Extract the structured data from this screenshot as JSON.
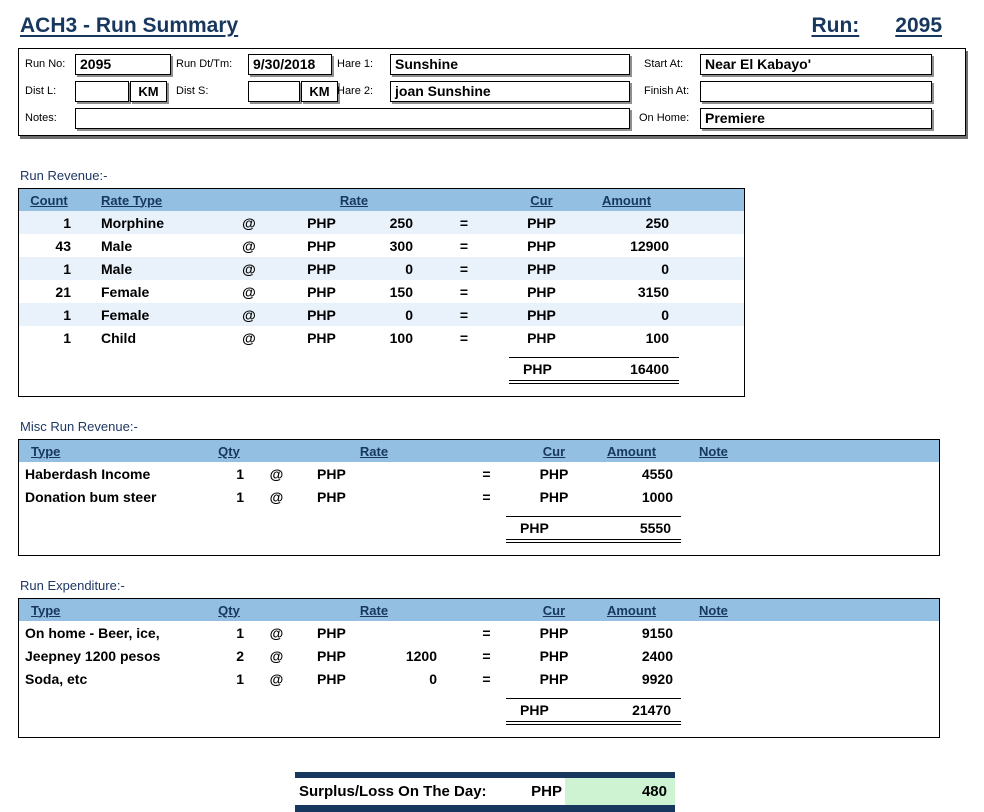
{
  "header": {
    "title": "ACH3 - Run Summary",
    "run_label": "Run:",
    "run_number": "2095"
  },
  "symbols": {
    "at": "@",
    "eq": "=",
    "php": "PHP",
    "km": "KM"
  },
  "form": {
    "run_no_label": "Run No:",
    "run_no": "2095",
    "run_dt_label": "Run Dt/Tm:",
    "run_dt": "9/30/2018",
    "hare1_label": "Hare 1:",
    "hare1": "Sunshine",
    "start_at_label": "Start At:",
    "start_at": "Near El Kabayo'",
    "dist_l_label": "Dist L:",
    "dist_l": "",
    "dist_s_label": "Dist S:",
    "dist_s": "",
    "hare2_label": "Hare 2:",
    "hare2": "joan Sunshine",
    "finish_at_label": "Finish At:",
    "finish_at": "",
    "notes_label": "Notes:",
    "notes": "",
    "on_home_label": "On Home:",
    "on_home": "Premiere"
  },
  "run_revenue": {
    "section_label": "Run Revenue:-",
    "headers": {
      "count": "Count",
      "rate_type": "Rate Type",
      "rate": "Rate",
      "cur": "Cur",
      "amount": "Amount"
    },
    "rows": [
      {
        "count": "1",
        "rate_type": "Morphine",
        "rate": "250",
        "amount": "250"
      },
      {
        "count": "43",
        "rate_type": "Male",
        "rate": "300",
        "amount": "12900"
      },
      {
        "count": "1",
        "rate_type": "Male",
        "rate": "0",
        "amount": "0"
      },
      {
        "count": "21",
        "rate_type": "Female",
        "rate": "150",
        "amount": "3150"
      },
      {
        "count": "1",
        "rate_type": "Female",
        "rate": "0",
        "amount": "0"
      },
      {
        "count": "1",
        "rate_type": "Child",
        "rate": "100",
        "amount": "100"
      }
    ],
    "total_amount": "16400"
  },
  "misc_revenue": {
    "section_label": "Misc Run Revenue:-",
    "headers": {
      "type": "Type",
      "qty": "Qty",
      "rate": "Rate",
      "cur": "Cur",
      "amount": "Amount",
      "note": "Note"
    },
    "rows": [
      {
        "type": "Haberdash Income",
        "qty": "1",
        "rate": "",
        "amount": "4550",
        "note": ""
      },
      {
        "type": "Donation bum steer",
        "qty": "1",
        "rate": "",
        "amount": "1000",
        "note": ""
      }
    ],
    "total_amount": "5550"
  },
  "expenditure": {
    "section_label": "Run Expenditure:-",
    "headers": {
      "type": "Type",
      "qty": "Qty",
      "rate": "Rate",
      "cur": "Cur",
      "amount": "Amount",
      "note": "Note"
    },
    "rows": [
      {
        "type": "On home - Beer, ice,",
        "qty": "1",
        "rate": "",
        "amount": "9150",
        "note": ""
      },
      {
        "type": "Jeepney 1200 pesos",
        "qty": "2",
        "rate": "1200",
        "amount": "2400",
        "note": ""
      },
      {
        "type": "Soda, etc",
        "qty": "1",
        "rate": "0",
        "amount": "9920",
        "note": ""
      }
    ],
    "total_amount": "21470"
  },
  "surplus": {
    "label": "Surplus/Loss On The Day:",
    "cur": "PHP",
    "amount": "480"
  },
  "colors": {
    "navy": "#17375E",
    "header_blue": "#93BFE3",
    "alt_row": "#E9F2FB",
    "surplus_green": "#CDF3D2"
  }
}
